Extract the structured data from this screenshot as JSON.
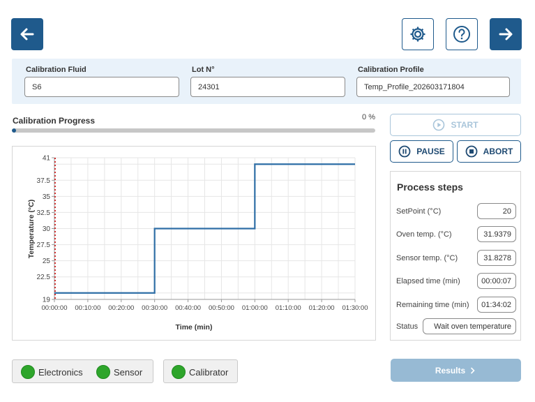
{
  "toolbar": {
    "back_icon": "arrow-left-icon",
    "settings_icon": "gear-icon",
    "help_icon": "question-icon",
    "next_icon": "arrow-right-icon",
    "accent_color": "#1f5a8c"
  },
  "fields": {
    "fluid_label": "Calibration Fluid",
    "fluid_value": "S6",
    "lot_label": "Lot N°",
    "lot_value": "24301",
    "profile_label": "Calibration Profile",
    "profile_value": "Temp_Profile_202603171804"
  },
  "progress": {
    "title": "Calibration Progress",
    "percent_label": "0 %",
    "value": 0
  },
  "controls": {
    "start_label": "START",
    "pause_label": "PAUSE",
    "abort_label": "ABORT"
  },
  "steps": {
    "title": "Process steps",
    "rows": [
      {
        "label": "SetPoint (°C)",
        "value": "20"
      },
      {
        "label": "Oven temp. (°C)",
        "value": "31.9379"
      },
      {
        "label": "Sensor temp. (°C)",
        "value": "31.8278"
      },
      {
        "label": "Elapsed time (min)",
        "value": "00:00:07"
      },
      {
        "label": "Remaining time (min)",
        "value": "01:34:02"
      },
      {
        "label": "Status",
        "value": "Wait oven temperature"
      }
    ]
  },
  "status_indicators": {
    "electronics": "Electronics",
    "sensor": "Sensor",
    "calibrator": "Calibrator",
    "ok_color": "#2ea52b"
  },
  "results": {
    "label": "Results"
  },
  "chart_data": {
    "type": "line",
    "title": "",
    "xlabel": "Time (min)",
    "ylabel": "Temperature (°C)",
    "xlim": [
      0,
      90
    ],
    "ylim": [
      19,
      41
    ],
    "grid": true,
    "x_ticks": [
      0,
      10,
      20,
      30,
      40,
      50,
      60,
      70,
      80,
      90
    ],
    "x_tick_labels": [
      "00:00:00",
      "00:10:00",
      "00:20:00",
      "00:30:00",
      "00:40:00",
      "00:50:00",
      "01:00:00",
      "01:10:00",
      "01:20:00",
      "01:30:00"
    ],
    "y_ticks": [
      19,
      22.5,
      25,
      27.5,
      30,
      32.5,
      35,
      37.5,
      41
    ],
    "y_tick_labels": [
      "19",
      "22.5",
      "25",
      "27.5",
      "30",
      "32.5",
      "35",
      "37.5",
      "41"
    ],
    "series": [
      {
        "color": "#2e6ea6",
        "x": [
          0,
          30,
          30,
          60,
          60,
          90
        ],
        "y": [
          20,
          20,
          30,
          30,
          40,
          40
        ]
      }
    ],
    "current_time_marker": {
      "x": 0,
      "color": "#d01f1f",
      "style": "dotted"
    }
  }
}
